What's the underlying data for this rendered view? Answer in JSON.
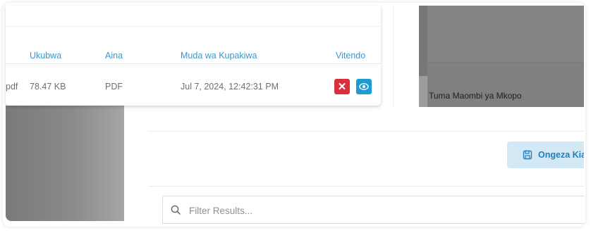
{
  "table": {
    "headers": {
      "size": "Ukubwa",
      "type": "Aina",
      "upload_time": "Muda wa Kupakiwa",
      "actions": "Vitendo"
    },
    "rows": [
      {
        "ext_fragment": "pdf",
        "size": "78.47 KB",
        "type": "PDF",
        "upload_time": "Jul 7, 2024, 12:42:31 PM"
      }
    ]
  },
  "right_panel": {
    "label": "Tuma Maombi ya Mkopo"
  },
  "save_button": {
    "label": "Ongeza Kia"
  },
  "filter": {
    "placeholder": "Filter Results..."
  },
  "colors": {
    "header_text": "#3d97c9",
    "delete_button": "#d9303b",
    "view_button": "#1d9bd2",
    "save_button_bg": "#d3e8f5",
    "save_button_text": "#1f7fc1"
  },
  "icons": {
    "delete": "close-icon",
    "view": "eye-icon",
    "save": "floppy-disk-icon",
    "filter": "search-icon"
  }
}
